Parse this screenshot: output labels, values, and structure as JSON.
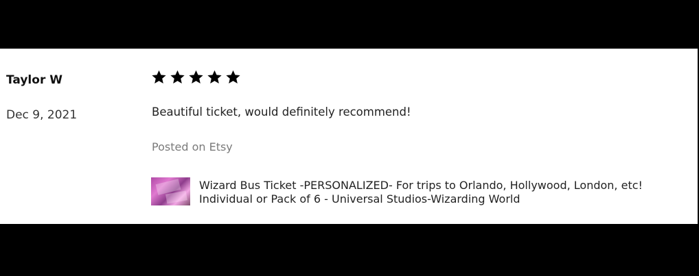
{
  "review": {
    "reviewer_name": "Taylor W",
    "date": "Dec 9, 2021",
    "rating": 5,
    "max_rating": 5,
    "text": "Beautiful ticket, would definitely recommend!",
    "posted_on": "Posted on Etsy",
    "product": {
      "title_line_1": "Wizard Bus Ticket -PERSONALIZED- For trips to Orlando, Hollywood, London, etc!",
      "title_line_2": "Individual or Pack of 6 - Universal Studios-Wizarding World",
      "thumbnail_icon": "product-thumbnail"
    }
  },
  "colors": {
    "background_band": "#000000",
    "card_background": "#ffffff",
    "text_primary": "#222222",
    "text_muted": "#7a7a7a",
    "star_fill": "#000000"
  }
}
